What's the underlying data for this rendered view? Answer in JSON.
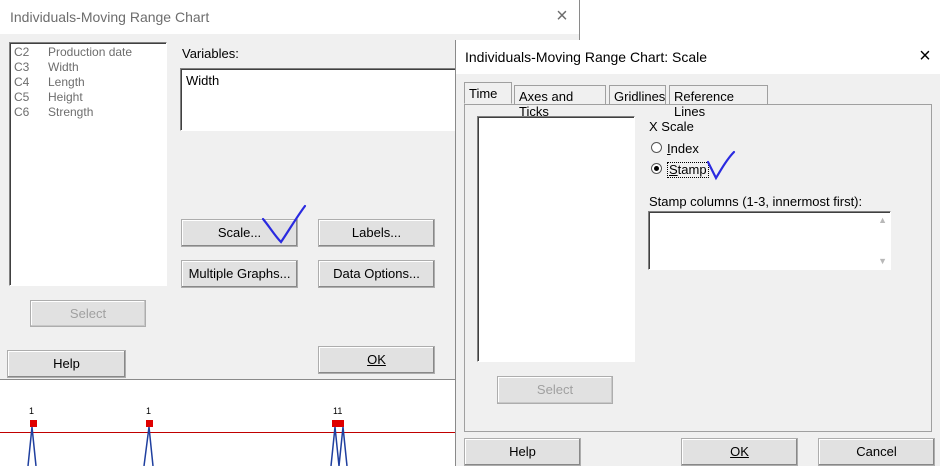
{
  "main_dialog": {
    "title": "Individuals-Moving Range Chart",
    "columns": [
      {
        "id": "C2",
        "name": "Production date"
      },
      {
        "id": "C3",
        "name": "Width"
      },
      {
        "id": "C4",
        "name": "Length"
      },
      {
        "id": "C5",
        "name": "Height"
      },
      {
        "id": "C6",
        "name": "Strength"
      }
    ],
    "variables_label": "Variables:",
    "variables_value": "Width",
    "buttons": {
      "scale": "Scale...",
      "labels": "Labels...",
      "multiple_graphs": "Multiple Graphs...",
      "data_options": "Data Options...",
      "select": "Select",
      "help": "Help",
      "ok": "OK"
    }
  },
  "scale_dialog": {
    "title": "Individuals-Moving Range Chart: Scale",
    "tabs": [
      "Time",
      "Axes and Ticks",
      "Gridlines",
      "Reference Lines"
    ],
    "active_tab": "Time",
    "x_scale_label": "X Scale",
    "options": [
      {
        "label": "Index",
        "selected": false
      },
      {
        "label": "Stamp",
        "selected": true
      }
    ],
    "stamp_columns_label": "Stamp columns (1-3, innermost first):",
    "buttons": {
      "select": "Select",
      "help": "Help",
      "ok": "OK",
      "cancel": "Cancel"
    }
  },
  "background_chart": {
    "point_labels": [
      "1",
      "1",
      "11"
    ],
    "line_color": "#c00000",
    "marker_color": "#e00000",
    "data_color": "#1f3f9f"
  },
  "annotation_color": "#2a2ae0"
}
